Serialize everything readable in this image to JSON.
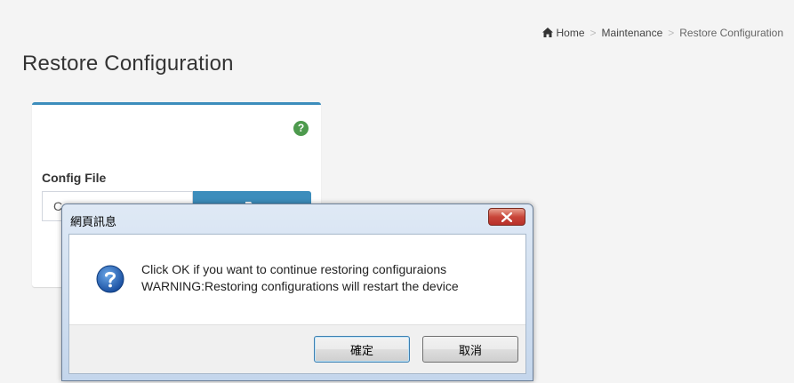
{
  "page": {
    "title": "Restore Configuration"
  },
  "breadcrumb": {
    "home": "Home",
    "separator": ">",
    "parent": "Maintenance",
    "current": "Restore Configuration"
  },
  "config_card": {
    "help_symbol": "?",
    "field_label": "Config File",
    "file_input_value": "C",
    "accent_color": "#3c8dbc"
  },
  "dialog": {
    "title": "網頁訊息",
    "message_line1": "Click OK if you want to continue restoring configuraions",
    "message_line2": "WARNING:Restoring configurations will restart the device",
    "ok_label": "確定",
    "cancel_label": "取消",
    "icon": "question-icon"
  }
}
